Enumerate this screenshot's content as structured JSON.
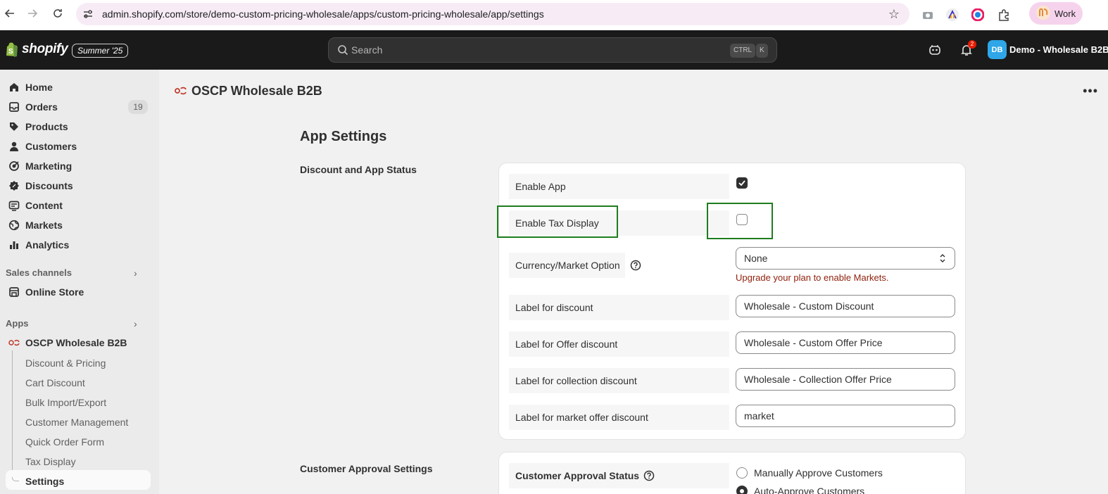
{
  "browser": {
    "url": "admin.shopify.com/store/demo-custom-pricing-wholesale/apps/custom-pricing-wholesale/app/settings",
    "profile_label": "Work"
  },
  "topbar": {
    "brand": "shopify",
    "edition": "Summer '25",
    "search_placeholder": "Search",
    "shortcut_key1": "CTRL",
    "shortcut_key2": "K",
    "notification_count": "2",
    "avatar_initials": "DB",
    "store_name": "Demo - Wholesale B2B"
  },
  "sidebar": {
    "items": [
      {
        "label": "Home",
        "icon": "home-icon"
      },
      {
        "label": "Orders",
        "icon": "inbox-icon",
        "count": "19"
      },
      {
        "label": "Products",
        "icon": "tag-icon"
      },
      {
        "label": "Customers",
        "icon": "person-icon"
      },
      {
        "label": "Marketing",
        "icon": "target-icon"
      },
      {
        "label": "Discounts",
        "icon": "discount-icon"
      },
      {
        "label": "Content",
        "icon": "content-icon"
      },
      {
        "label": "Markets",
        "icon": "globe-icon"
      },
      {
        "label": "Analytics",
        "icon": "bar-chart-icon"
      }
    ],
    "sales_channels_label": "Sales channels",
    "online_store": "Online Store",
    "apps_label": "Apps",
    "app_name": "OSCP Wholesale B2B",
    "app_sub_items": [
      "Discount & Pricing",
      "Cart Discount",
      "Bulk Import/Export",
      "Customer Management",
      "Quick Order Form",
      "Tax Display",
      "Settings"
    ]
  },
  "main": {
    "app_title": "OSCP Wholesale B2B",
    "page_heading": "App Settings",
    "section1_heading": "Discount and App Status",
    "section2_heading": "Customer Approval Settings",
    "rows": {
      "enable_app": "Enable App",
      "enable_tax": "Enable Tax Display",
      "currency": "Currency/Market Option",
      "label_discount": "Label for discount",
      "label_offer": "Label for Offer discount",
      "label_collection": "Label for collection discount",
      "label_market": "Label for market offer discount"
    },
    "values": {
      "enable_app_checked": true,
      "enable_tax_checked": false,
      "currency_selected": "None",
      "currency_error": "Upgrade your plan to enable Markets.",
      "label_discount": "Wholesale - Custom Discount",
      "label_offer": "Wholesale - Custom Offer Price",
      "label_collection": "Wholesale - Collection Offer Price",
      "label_market": "market"
    },
    "approval": {
      "label": "Customer Approval Status",
      "option_manual": "Manually Approve Customers",
      "option_auto": "Auto-Approve Customers"
    }
  }
}
